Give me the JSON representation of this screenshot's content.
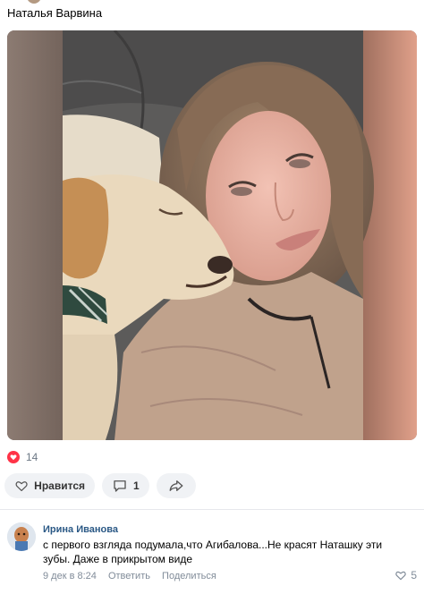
{
  "post": {
    "author": "Наталья Варвина"
  },
  "reactions": {
    "likes_count": "14",
    "like_label": "Нравится",
    "comments_count": "1"
  },
  "comment": {
    "author": "Ирина Иванова",
    "text": "с первого взгляда подумала,что Агибалова...Не красят Наташку эти зубы. Даже в прикрытом виде",
    "timestamp": "9 дек в 8:24",
    "reply_label": "Ответить",
    "share_label": "Поделиться",
    "likes_count": "5"
  },
  "colors": {
    "accent": "#2a5885",
    "heart": "#ff3347",
    "muted": "#818c99"
  }
}
